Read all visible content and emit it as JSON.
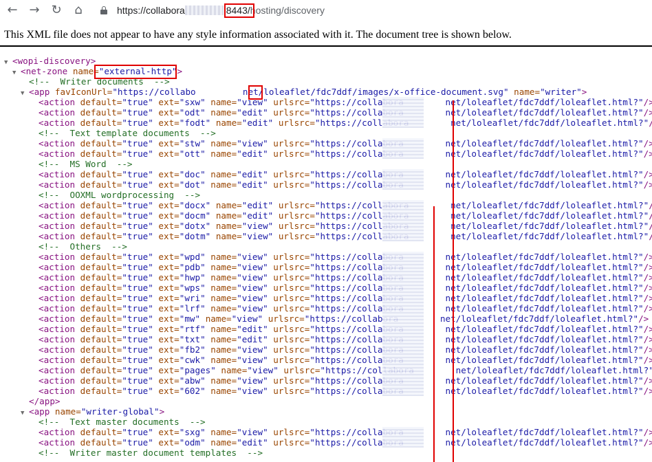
{
  "browser": {
    "url_prefix": "https://collabora",
    "url_port": ":8443/",
    "url_suffix": "hosting/discovery"
  },
  "notice": "This XML file does not appear to have any style information associated with it. The document tree is shown below.",
  "xml": {
    "root_open": "<wopi-discovery>",
    "netzone": {
      "tag": "<net-zone ",
      "attr": "name=",
      "value": "\"external-http\"",
      "close": ">"
    },
    "apps": [
      {
        "open_tag": "<app ",
        "fav_attr": "favIconUrl=",
        "fav_value_pre": "\"https://collabo",
        "fav_value_post": "net/loleaflet/fdc7ddf/images/x-office-document.svg\"",
        "name_attr": " name=",
        "name_value": "\"writer\"",
        "close": ">"
      },
      {
        "open_tag": "<app ",
        "name_attr": "name=",
        "name_value": "\"writer-global\"",
        "close": ">"
      }
    ],
    "app_close": "</app>",
    "lines": [
      {
        "type": "comment",
        "text": "<!--  Writer documents  -->"
      },
      {
        "type": "comment",
        "text": "<!--  Text template documents  -->"
      },
      {
        "type": "comment",
        "text": "<!--  MS Word  -->"
      },
      {
        "type": "comment",
        "text": "<!--  OOXML wordprocessing  -->"
      },
      {
        "type": "comment",
        "text": "<!--  Others  -->"
      },
      {
        "type": "comment",
        "text": "<!--  Text master documents  -->"
      },
      {
        "type": "comment",
        "text": "<!--  Writer master document templates  -->"
      }
    ],
    "actions": [
      {
        "ext": "\"sxw\"",
        "name": "\"view\""
      },
      {
        "ext": "\"odt\"",
        "name": "\"edit\""
      },
      {
        "ext": "\"fodt\"",
        "name": "\"edit\""
      },
      {
        "ext": "\"stw\"",
        "name": "\"view\""
      },
      {
        "ext": "\"ott\"",
        "name": "\"edit\""
      },
      {
        "ext": "\"doc\"",
        "name": "\"edit\""
      },
      {
        "ext": "\"dot\"",
        "name": "\"edit\""
      },
      {
        "ext": "\"docx\"",
        "name": "\"edit\""
      },
      {
        "ext": "\"docm\"",
        "name": "\"edit\""
      },
      {
        "ext": "\"dotx\"",
        "name": "\"view\""
      },
      {
        "ext": "\"dotm\"",
        "name": "\"view\""
      },
      {
        "ext": "\"wpd\"",
        "name": "\"view\""
      },
      {
        "ext": "\"pdb\"",
        "name": "\"view\""
      },
      {
        "ext": "\"hwp\"",
        "name": "\"view\""
      },
      {
        "ext": "\"wps\"",
        "name": "\"view\""
      },
      {
        "ext": "\"wri\"",
        "name": "\"view\""
      },
      {
        "ext": "\"lrf\"",
        "name": "\"view\""
      },
      {
        "ext": "\"mw\"",
        "name": "\"view\""
      },
      {
        "ext": "\"rtf\"",
        "name": "\"edit\""
      },
      {
        "ext": "\"txt\"",
        "name": "\"edit\""
      },
      {
        "ext": "\"fb2\"",
        "name": "\"view\""
      },
      {
        "ext": "\"cwk\"",
        "name": "\"view\""
      },
      {
        "ext": "\"pages\"",
        "name": "\"view\""
      },
      {
        "ext": "\"abw\"",
        "name": "\"view\""
      },
      {
        "ext": "\"602\"",
        "name": "\"view\""
      },
      {
        "ext": "\"sxg\"",
        "name": "\"view\""
      },
      {
        "ext": "\"odm\"",
        "name": "\"edit\""
      }
    ],
    "action_parts": {
      "tag": "<action ",
      "default_attr": "default=",
      "default_value": "\"true\"",
      "ext_attr": " ext=",
      "name_attr": " name=",
      "urlsrc_attr": " urlsrc=",
      "urlsrc_pre": "\"https://collabora",
      "urlsrc_post": "net/loleaflet/fdc7ddf/loleaflet.html?\"",
      "close": "/>"
    }
  }
}
